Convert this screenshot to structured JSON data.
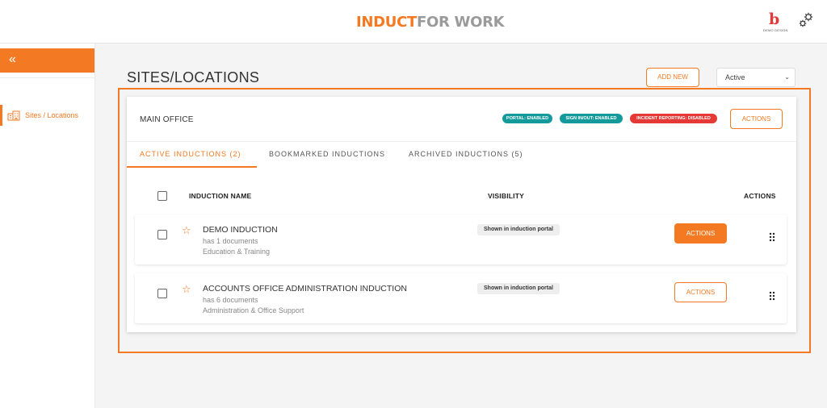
{
  "header": {
    "logo_part1": "INDUCT",
    "logo_part2": "FOR WORK",
    "brand_letter": "b",
    "brand_caption": "DEMO DESIGN"
  },
  "sidebar": {
    "collapse_icon": "«",
    "items": [
      {
        "label": "Sites / Locations",
        "icon": "buildings-icon"
      }
    ]
  },
  "page": {
    "title": "SITES/LOCATIONS",
    "add_new_label": "ADD NEW",
    "status_filter": {
      "selected": "Active",
      "chevron": "⌄"
    }
  },
  "site": {
    "name": "MAIN OFFICE",
    "badges": [
      {
        "label": "PORTAL: ENABLED",
        "color": "#159a9c"
      },
      {
        "label": "SIGN IN/OUT: ENABLED",
        "color": "#159a9c"
      },
      {
        "label": "INCIDENT REPORTING: DISABLED",
        "color": "#e53935"
      }
    ],
    "actions_label": "ACTIONS"
  },
  "tabs": [
    {
      "label": "ACTIVE INDUCTIONS  (2)",
      "active": true
    },
    {
      "label": "BOOKMARKED INDUCTIONS",
      "active": false
    },
    {
      "label": "ARCHIVED INDUCTIONS  (5)",
      "active": false
    }
  ],
  "table": {
    "columns": {
      "name": "INDUCTION NAME",
      "visibility": "VISIBILITY",
      "actions": "ACTIONS"
    },
    "rows": [
      {
        "name": "DEMO INDUCTION",
        "documents": "has 1 documents",
        "category": "Education & Training",
        "visibility": "Shown in induction portal",
        "action_label": "ACTIONS",
        "action_style": "filled"
      },
      {
        "name": "ACCOUNTS OFFICE ADMINISTRATION INDUCTION",
        "documents": "has 6 documents",
        "category": "Administration & Office Support",
        "visibility": "Shown in induction portal",
        "action_label": "ACTIONS",
        "action_style": "outline"
      }
    ]
  },
  "colors": {
    "accent": "#f37a22",
    "teal": "#159a9c",
    "danger": "#e53935"
  }
}
